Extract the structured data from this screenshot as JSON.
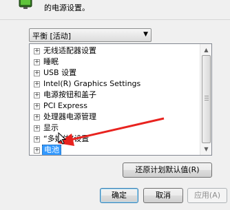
{
  "header": {
    "description": "的电源设置。",
    "icon": "battery-icon"
  },
  "scheme_select": {
    "value": "平衡 [活动]"
  },
  "tree": {
    "items": [
      {
        "label": "无线适配器设置",
        "expander": "+",
        "selected": false
      },
      {
        "label": "睡眠",
        "expander": "+",
        "selected": false
      },
      {
        "label": "USB 设置",
        "expander": "+",
        "selected": false
      },
      {
        "label": "Intel(R) Graphics Settings",
        "expander": "+",
        "selected": false
      },
      {
        "label": "电源按钮和盖子",
        "expander": "+",
        "selected": false
      },
      {
        "label": "PCI Express",
        "expander": "+",
        "selected": false
      },
      {
        "label": "处理器电源管理",
        "expander": "+",
        "selected": false
      },
      {
        "label": "显示",
        "expander": "+",
        "selected": false
      },
      {
        "label": "“多媒体”设置",
        "expander": "+",
        "selected": false
      },
      {
        "label": "电池",
        "expander": "+",
        "selected": true
      }
    ]
  },
  "buttons": {
    "restore": "还原计划默认值(R)",
    "ok": "确定",
    "cancel": "取消",
    "apply": "应用(A)"
  },
  "colors": {
    "selection": "#3399ff",
    "annotation_arrow": "#e8231f"
  }
}
